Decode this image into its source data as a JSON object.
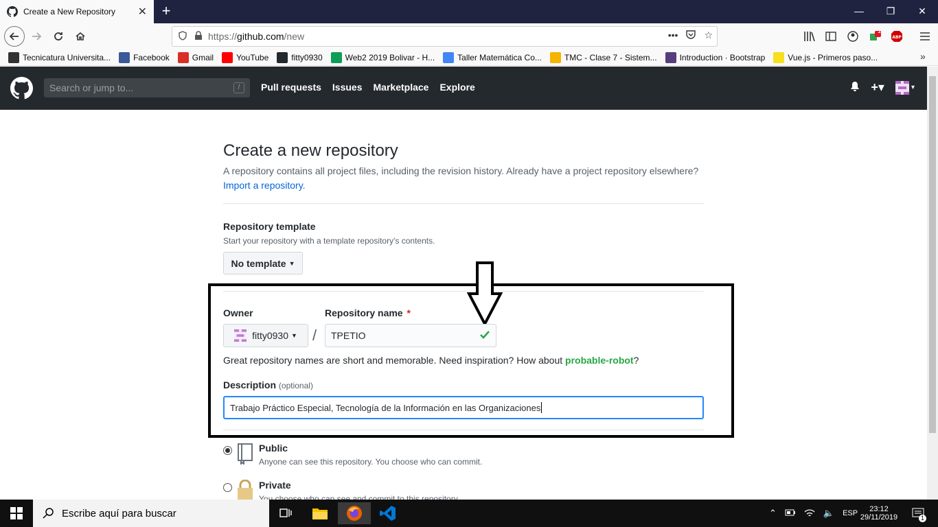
{
  "browser": {
    "tab_title": "Create a New Repository",
    "url_prefix": "https://",
    "url_domain": "github.com",
    "url_path": "/new",
    "abp_badge": "1",
    "bookmarks": [
      {
        "label": "Tecnicatura Universita...",
        "icon": "bookmark-icon-tecnicatura",
        "color": "#333333"
      },
      {
        "label": "Facebook",
        "icon": "facebook-icon",
        "color": "#3b5998"
      },
      {
        "label": "Gmail",
        "icon": "gmail-icon",
        "color": "#d93025"
      },
      {
        "label": "YouTube",
        "icon": "youtube-icon",
        "color": "#ff0000"
      },
      {
        "label": "fitty0930",
        "icon": "github-icon",
        "color": "#24292e"
      },
      {
        "label": "Web2 2019 Bolivar - H...",
        "icon": "sheets-icon",
        "color": "#0f9d58"
      },
      {
        "label": "Taller Matemática Co...",
        "icon": "page-icon",
        "color": "#4285f4"
      },
      {
        "label": "TMC - Clase 7 - Sistem...",
        "icon": "drive-icon",
        "color": "#f4b400"
      },
      {
        "label": "Introduction · Bootstrap",
        "icon": "bootstrap-icon",
        "color": "#563d7c"
      },
      {
        "label": "Vue.js - Primeros paso...",
        "icon": "vue-icon",
        "color": "#f7df1e"
      }
    ]
  },
  "github": {
    "search_placeholder": "Search or jump to...",
    "search_shortcut": "/",
    "nav": [
      "Pull requests",
      "Issues",
      "Marketplace",
      "Explore"
    ]
  },
  "page": {
    "title": "Create a new repository",
    "subtitle": "A repository contains all project files, including the revision history. Already have a project repository elsewhere?",
    "import_link": "Import a repository.",
    "template_label": "Repository template",
    "template_note": "Start your repository with a template repository's contents.",
    "template_button": "No template",
    "owner_label": "Owner",
    "owner_value": "fitty0930",
    "separator": "/",
    "repo_name_label": "Repository name",
    "required_mark": "*",
    "repo_name_value": "TPETIO",
    "name_hint": "Great repository names are short and memorable. Need inspiration? How about",
    "name_suggestion": "probable-robot",
    "name_hint_end": "?",
    "description_label": "Description",
    "description_optional": "(optional)",
    "description_value": "Trabajo Práctico Especial, Tecnología de la Información en las Organizaciones",
    "public_label": "Public",
    "public_note": "Anyone can see this repository. You choose who can commit.",
    "private_label": "Private",
    "private_note": "You choose who can see and commit to this repository."
  },
  "taskbar": {
    "search_placeholder": "Escribe aquí para buscar",
    "language": "ESP",
    "time": "23:12",
    "date": "29/11/2019",
    "notification_count": "1"
  },
  "colors": {
    "github_header": "#24292e",
    "link": "#0366d6",
    "suggestion": "#28a745",
    "focus_border": "#2188ff"
  }
}
